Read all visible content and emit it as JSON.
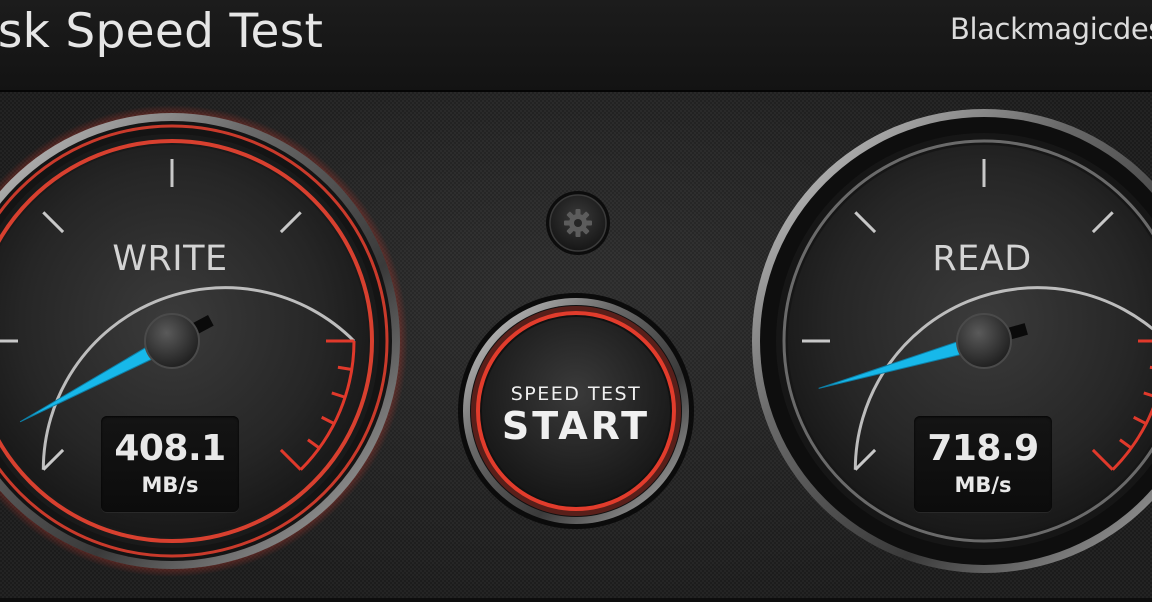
{
  "window": {
    "title": "Disk Speed Test",
    "brand": "Blackmagicdesign"
  },
  "settings": {
    "icon": "gear-icon"
  },
  "start_button": {
    "caption": "SPEED TEST",
    "label": "START"
  },
  "gauges": {
    "write": {
      "label": "WRITE",
      "value": "408.1",
      "unit": "MB/s",
      "needle_deg": 242
    },
    "read": {
      "label": "READ",
      "value": "718.9",
      "unit": "MB/s",
      "needle_deg": 254
    }
  },
  "colors": {
    "needle": "#17b8ea",
    "accent_red": "#e0392b",
    "background": "#1e1e1e"
  }
}
